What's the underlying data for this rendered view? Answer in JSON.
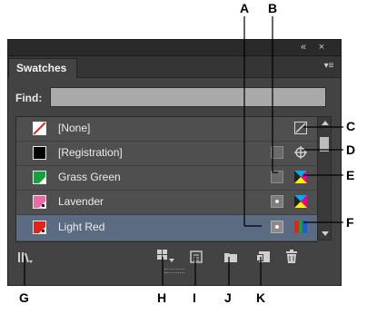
{
  "panel": {
    "title": "Swatches",
    "find_label": "Find:",
    "find_value": ""
  },
  "swatches": [
    {
      "label": "[None]",
      "chip_color": "#ffffff",
      "selected": false
    },
    {
      "label": "[Registration]",
      "chip_color": "#000000",
      "selected": false
    },
    {
      "label": "Grass Green",
      "chip_color": "#13a33a",
      "selected": false
    },
    {
      "label": "Lavender",
      "chip_color": "#e86aa6",
      "selected": false
    },
    {
      "label": "Light Red",
      "chip_color": "#e2231a",
      "selected": true
    }
  ],
  "callouts": {
    "A": "A",
    "B": "B",
    "C": "C",
    "D": "D",
    "E": "E",
    "F": "F",
    "G": "G",
    "H": "H",
    "I": "I",
    "J": "J",
    "K": "K"
  },
  "icons": {
    "collapse": "double-chevron-left-icon",
    "close": "close-icon",
    "panel_menu": "panel-menu-icon",
    "library": "cc-library-icon",
    "show_kinds": "show-swatch-kinds-icon",
    "options": "swatch-options-icon",
    "new_group": "new-color-group-icon",
    "new_swatch": "new-swatch-icon",
    "delete": "trash-icon"
  },
  "colors": {
    "panel_bg": "#434343",
    "selected_row": "#5a6b82"
  }
}
